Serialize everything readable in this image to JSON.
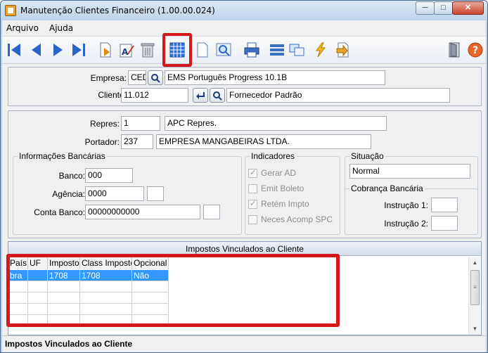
{
  "window": {
    "title": "Manutenção Clientes Financeiro (1.00.00.024)"
  },
  "menu": {
    "arquivo": "Arquivo",
    "ajuda": "Ajuda"
  },
  "header": {
    "empresa_label": "Empresa:",
    "empresa_code": "CED",
    "empresa_name": "EMS Português Progress 10.1B",
    "cliente_label": "Cliente:",
    "cliente_code": "11.012",
    "cliente_name": "Fornecedor Padrão"
  },
  "detail": {
    "repres_label": "Repres:",
    "repres_code": "1",
    "repres_name": "APC Repres.",
    "portador_label": "Portador:",
    "portador_code": "237",
    "portador_name": "EMPRESA MANGABEIRAS LTDA."
  },
  "bank": {
    "group_label": "Informações Bancárias",
    "banco_label": "Banco:",
    "banco": "000",
    "agencia_label": "Agência:",
    "agencia": "0000",
    "agencia_dv": "",
    "conta_label": "Conta Banco:",
    "conta": "00000000000",
    "conta_dv": ""
  },
  "indicadores": {
    "group_label": "Indicadores",
    "items": [
      {
        "label": "Gerar AD",
        "checked": true
      },
      {
        "label": "Emit Boleto",
        "checked": false
      },
      {
        "label": "Retém Impto",
        "checked": true
      },
      {
        "label": "Neces Acomp SPC",
        "checked": false
      }
    ]
  },
  "situacao": {
    "group_label": "Situação",
    "value": "Normal"
  },
  "cobranca": {
    "group_label": "Cobrança Bancária",
    "instrucao1_label": "Instrução 1:",
    "instrucao1": "",
    "instrucao2_label": "Instrução 2:",
    "instrucao2": ""
  },
  "grid": {
    "title": "Impostos Vinculados ao Cliente",
    "columns": [
      "País",
      "UF",
      "Imposto",
      "Class Imposto",
      "Opcional"
    ],
    "rows": [
      [
        "bra",
        "",
        "1708",
        "1708",
        "Não"
      ]
    ]
  },
  "status": {
    "text": "Impostos Vinculados ao Cliente"
  },
  "colors": {
    "highlight": "#d3171b",
    "selection": "#3399ff"
  }
}
